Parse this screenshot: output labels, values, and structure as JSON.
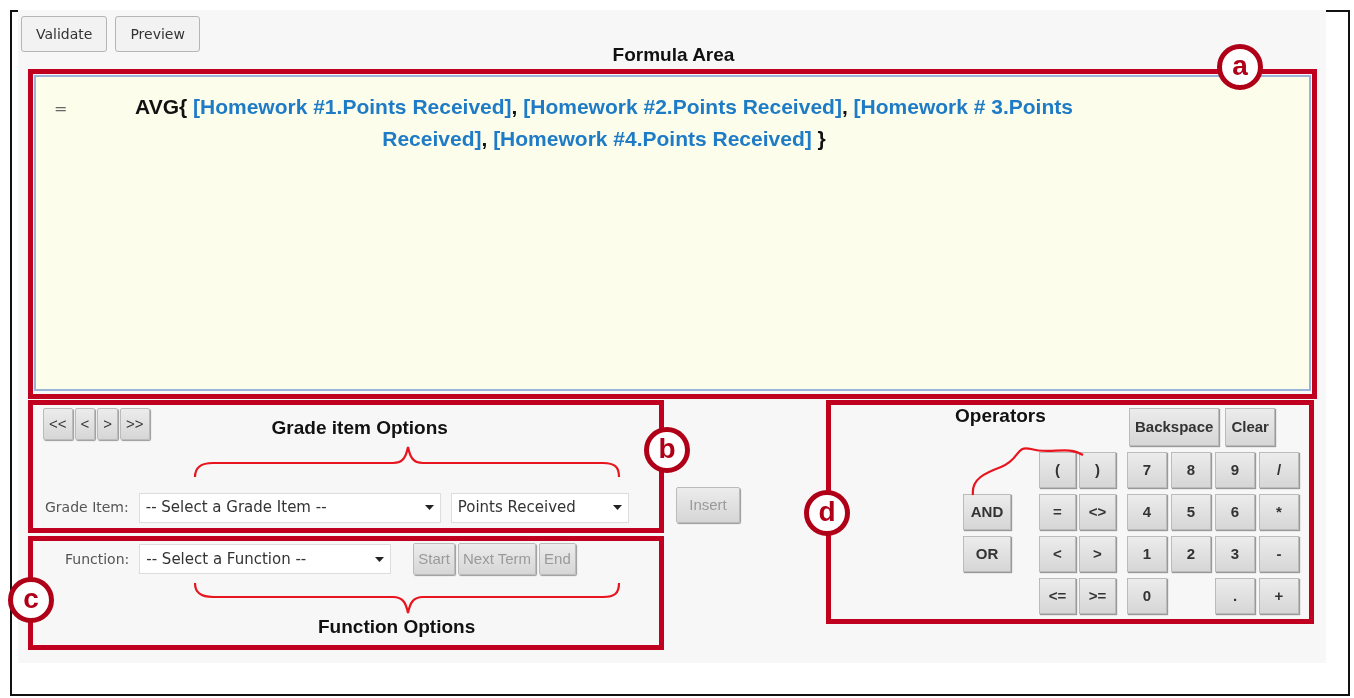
{
  "toolbar": [
    {
      "label": "Validate",
      "disabled": false
    },
    {
      "label": "Preview",
      "disabled": false
    }
  ],
  "formula_area": {
    "title": "Formula Area",
    "callout": "a",
    "prefix": "=",
    "segments": [
      {
        "kind": "text",
        "text": "AVG{ "
      },
      {
        "kind": "ref",
        "text": "[Homework #1.Points Received]"
      },
      {
        "kind": "text",
        "text": ", "
      },
      {
        "kind": "ref",
        "text": "[Homework #2.Points Received]"
      },
      {
        "kind": "text",
        "text": ", "
      },
      {
        "kind": "ref",
        "text": "[Homework # 3.Points Received]"
      },
      {
        "kind": "text",
        "text": ", "
      },
      {
        "kind": "ref",
        "text": "[Homework #4.Points Received]"
      },
      {
        "kind": "text",
        "text": " }"
      }
    ]
  },
  "grade_item_options": {
    "callout": "b",
    "title": "Grade item Options",
    "nav": [
      {
        "label": "<<",
        "disabled": false
      },
      {
        "label": "<",
        "disabled": false
      },
      {
        "label": ">",
        "disabled": false
      },
      {
        "label": ">>",
        "disabled": false
      }
    ],
    "label": "Grade Item:",
    "item_select": "-- Select a Grade Item --",
    "field_select": "Points Received"
  },
  "insert_button": {
    "label": "Insert",
    "disabled": true
  },
  "function_options": {
    "callout": "c",
    "label": "Function:",
    "select": "-- Select a Function --",
    "buttons": [
      {
        "label": "Start",
        "disabled": true
      },
      {
        "label": "Next Term",
        "disabled": true
      },
      {
        "label": "End",
        "disabled": true
      }
    ],
    "title": "Function Options"
  },
  "operators": {
    "callout": "d",
    "title": "Operators",
    "edit_buttons": [
      "Backspace",
      "Clear"
    ],
    "logic": [
      "AND",
      "OR"
    ],
    "comparison": [
      "(",
      ")",
      "=",
      "<>",
      "<",
      ">",
      "<=",
      ">="
    ],
    "keypad": [
      {
        "kind": "key",
        "label": "7"
      },
      {
        "kind": "key",
        "label": "8"
      },
      {
        "kind": "key",
        "label": "9"
      },
      {
        "kind": "key",
        "label": "/"
      },
      {
        "kind": "key",
        "label": "4"
      },
      {
        "kind": "key",
        "label": "5"
      },
      {
        "kind": "key",
        "label": "6"
      },
      {
        "kind": "key",
        "label": "*"
      },
      {
        "kind": "key",
        "label": "1"
      },
      {
        "kind": "key",
        "label": "2"
      },
      {
        "kind": "key",
        "label": "3"
      },
      {
        "kind": "key",
        "label": "-"
      },
      {
        "kind": "key",
        "label": "0"
      },
      {
        "kind": "blank"
      },
      {
        "kind": "key",
        "label": "."
      },
      {
        "kind": "key",
        "label": "+"
      }
    ]
  }
}
